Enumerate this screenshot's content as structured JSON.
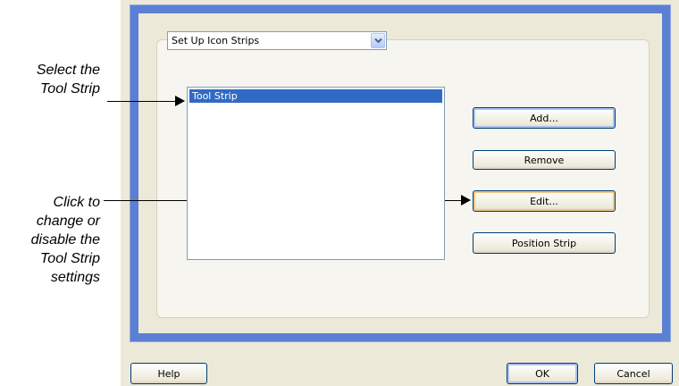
{
  "annotations": {
    "select": [
      "Select the",
      "Tool Strip"
    ],
    "click": [
      "Click to",
      "change or",
      "disable the",
      "Tool Strip",
      "settings"
    ]
  },
  "dialog": {
    "dropdown": {
      "value": "Set Up Icon Strips",
      "icon": "chevron-down-icon"
    },
    "listbox": {
      "items": [
        "Tool Strip"
      ],
      "selected_index": 0
    },
    "buttons": {
      "add": "Add...",
      "remove": "Remove",
      "edit": "Edit...",
      "position_strip": "Position Strip"
    },
    "footer": {
      "help": "Help",
      "ok": "OK",
      "cancel": "Cancel"
    }
  },
  "colors": {
    "frame_blue": "#5b7fd2",
    "selection": "#316ac5",
    "dialog_bg": "#ece9d8"
  }
}
